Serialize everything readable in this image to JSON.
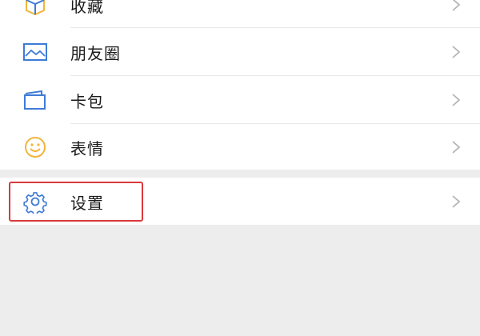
{
  "menu": {
    "items": [
      {
        "label": "收藏",
        "icon": "favorites-cube-icon"
      },
      {
        "label": "朋友圈",
        "icon": "moments-picture-icon"
      },
      {
        "label": "卡包",
        "icon": "card-wallet-icon"
      },
      {
        "label": "表情",
        "icon": "sticker-smiley-icon"
      }
    ],
    "settings": {
      "label": "设置",
      "icon": "gear-icon"
    }
  },
  "colors": {
    "accent_blue": "#3e7bd6",
    "accent_yellow": "#f2b53c",
    "highlight_border": "#d93a3a",
    "background": "#ededed"
  }
}
